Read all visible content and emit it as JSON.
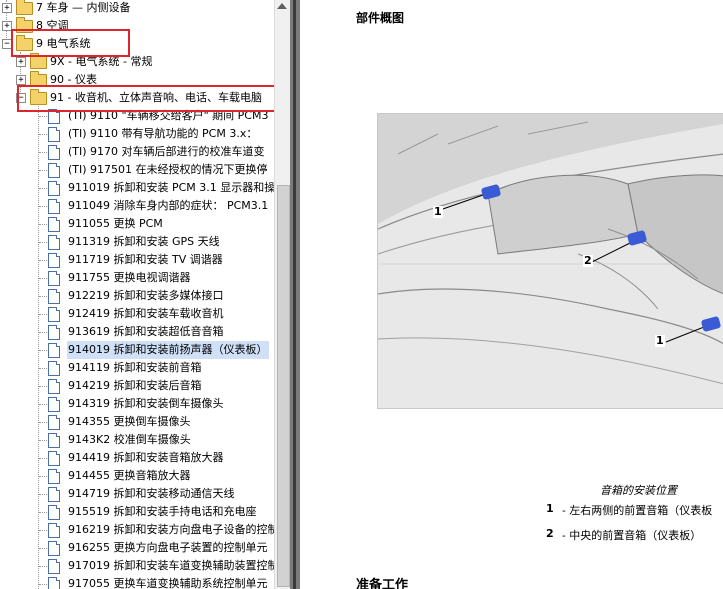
{
  "tree": {
    "items": [
      {
        "label": "7 车身 — 内侧设备",
        "kind": "folder"
      },
      {
        "label": "8 空调",
        "kind": "folder"
      },
      {
        "label": "9 电气系统",
        "kind": "folder",
        "expanded": true
      },
      {
        "label": "9X - 电气系统 - 常规",
        "kind": "folder"
      },
      {
        "label": "90 - 仪表",
        "kind": "folder"
      },
      {
        "label": "91 - 收音机、立体声音响、电话、车载电脑",
        "kind": "folder",
        "expanded": true
      },
      {
        "label": "(TI) 9110 \"车辆移交给客户\" 期间 PCM3",
        "kind": "doc"
      },
      {
        "label": "(TI) 9110 带有导航功能的 PCM 3.x：",
        "kind": "doc"
      },
      {
        "label": "(TI) 9170 对车辆后部进行的校准车道变",
        "kind": "doc"
      },
      {
        "label": "(TI) 917501 在未经授权的情况下更换停",
        "kind": "doc"
      },
      {
        "label": "911019 拆卸和安装 PCM 3.1 显示器和操",
        "kind": "doc"
      },
      {
        "label": "911049 消除车身内部的症状： PCM3.1",
        "kind": "doc"
      },
      {
        "label": "911055 更换 PCM",
        "kind": "doc"
      },
      {
        "label": "911319 拆卸和安装 GPS 天线",
        "kind": "doc"
      },
      {
        "label": "911719 拆卸和安装 TV 调谐器",
        "kind": "doc"
      },
      {
        "label": "911755 更换电视调谐器",
        "kind": "doc"
      },
      {
        "label": "912219 拆卸和安装多媒体接口",
        "kind": "doc"
      },
      {
        "label": "912419 拆卸和安装车载收音机",
        "kind": "doc"
      },
      {
        "label": "913619 拆卸和安装超低音音箱",
        "kind": "doc"
      },
      {
        "label": "914019 拆卸和安装前扬声器（仪表板）",
        "kind": "doc",
        "selected": true
      },
      {
        "label": "914119 拆卸和安装前音箱",
        "kind": "doc"
      },
      {
        "label": "914219 拆卸和安装后音箱",
        "kind": "doc"
      },
      {
        "label": "914319 拆卸和安装倒车摄像头",
        "kind": "doc"
      },
      {
        "label": "914355 更换倒车摄像头",
        "kind": "doc"
      },
      {
        "label": "9143K2 校准倒车摄像头",
        "kind": "doc"
      },
      {
        "label": "914419 拆卸和安装音箱放大器",
        "kind": "doc"
      },
      {
        "label": "914455 更换音箱放大器",
        "kind": "doc"
      },
      {
        "label": "914719 拆卸和安装移动通信天线",
        "kind": "doc"
      },
      {
        "label": "915519 拆卸和安装手持电话和充电座",
        "kind": "doc"
      },
      {
        "label": "916219 拆卸和安装方向盘电子设备的控制",
        "kind": "doc"
      },
      {
        "label": "916255 更换方向盘电子装置的控制单元",
        "kind": "doc"
      },
      {
        "label": "917019 拆卸和安装车道变换辅助装置控制",
        "kind": "doc"
      },
      {
        "label": "917055 更换车道变换辅助系统控制单元",
        "kind": "doc"
      }
    ]
  },
  "document": {
    "section_title": "部件概图",
    "figure_callouts": [
      "1",
      "2",
      "1"
    ],
    "caption": "音箱的安装位置",
    "legend": [
      {
        "num": "1",
        "text": "- 左右两侧的前置音箱（仪表板"
      },
      {
        "num": "2",
        "text": "- 中央的前置音箱（仪表板）"
      }
    ],
    "next_section_title": "准备工作"
  },
  "colors": {
    "highlight_box": "#e0242b",
    "selection": "#cfe0f7",
    "speaker": "#3b5bd6"
  }
}
